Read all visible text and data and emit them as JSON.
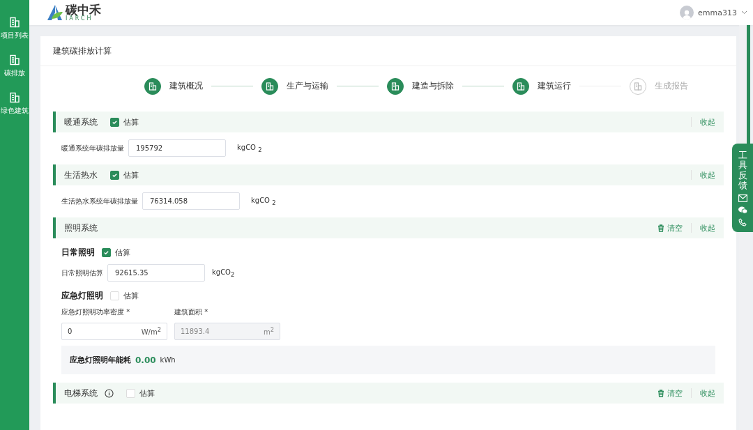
{
  "logo": {
    "name": "碳中禾",
    "subtitle": "IARCH"
  },
  "sidebar": {
    "items": [
      {
        "label": "项目列表"
      },
      {
        "label": "碳排放"
      },
      {
        "label": "绿色建筑"
      }
    ]
  },
  "user": {
    "name": "emma313"
  },
  "page_title": "建筑碳排放计算",
  "steps": [
    {
      "label": "建筑概况",
      "completed": true
    },
    {
      "label": "生产与运输",
      "completed": true
    },
    {
      "label": "建造与拆除",
      "completed": true
    },
    {
      "label": "建筑运行",
      "completed": true
    },
    {
      "label": "生成报告",
      "completed": false
    }
  ],
  "sections": [
    {
      "kind": "simple",
      "title": "暖通系统",
      "info": false,
      "estimate": {
        "label": "估算",
        "checked": true
      },
      "actions": [
        {
          "kind": "collapse",
          "label": "收起"
        }
      ],
      "field": {
        "label": "暖通系统年碳排放量",
        "value": "195792",
        "unit": "kgCO $_{2}$"
      }
    },
    {
      "kind": "simple",
      "title": "生活热水",
      "info": false,
      "estimate": {
        "label": "估算",
        "checked": true
      },
      "actions": [
        {
          "kind": "collapse",
          "label": "收起"
        }
      ],
      "field": {
        "label": "生活热水系统年碳排放量",
        "value": "76314.058",
        "unit": "kgCO $_{2}$"
      }
    },
    {
      "kind": "lighting",
      "title": "照明系统",
      "info": false,
      "actions": [
        {
          "kind": "clear",
          "label": "清空"
        },
        {
          "kind": "collapse",
          "label": "收起"
        }
      ],
      "daily": {
        "title": "日常照明",
        "estimate": {
          "label": "估算",
          "checked": true
        },
        "field": {
          "label": "日常照明估算",
          "value": "92615.35",
          "unit": "kgCO$_{2}$"
        }
      },
      "emergency": {
        "title": "应急灯照明",
        "estimate": {
          "label": "估算",
          "checked": false
        },
        "fields": [
          {
            "label": "应急灯照明功率密度 *",
            "value": "0",
            "unit": "W/m$^{2}$",
            "disabled": false
          },
          {
            "label": "建筑面积 *",
            "value": "11893.4",
            "unit": "m$^{2}$",
            "disabled": true
          }
        ],
        "result": {
          "label": "应急灯照明年能耗",
          "value": "0.00",
          "unit": "kWh"
        }
      }
    },
    {
      "kind": "header",
      "title": "电梯系统",
      "info": true,
      "estimate": {
        "label": "估算",
        "checked": false
      },
      "actions": [
        {
          "kind": "clear",
          "label": "清空"
        },
        {
          "kind": "collapse",
          "label": "收起"
        }
      ]
    }
  ],
  "feedback": {
    "label": "工具反馈"
  }
}
